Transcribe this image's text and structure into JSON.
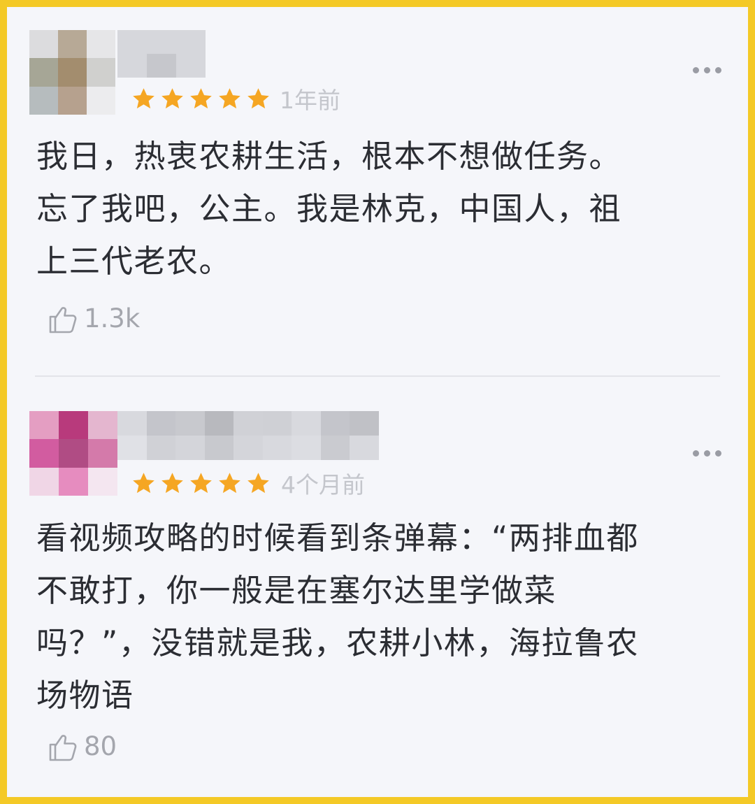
{
  "reviews": [
    {
      "time": "1年前",
      "rating": 5,
      "text_lines": [
        "我日，热衷农耕生活，根本不想做任务。",
        "忘了我吧，公主。我是林克，中国人，祖",
        "上三代老农。"
      ],
      "likes": "1.3k",
      "avatar_colors": [
        "#dcdcde",
        "#b7a996",
        "#e6e6e8",
        "#a6a696",
        "#a38d6e",
        "#d0d0ce",
        "#b6bcbe",
        "#b6a18e",
        "#ececee"
      ],
      "name_colors": [
        "#d6d7dc",
        "#d6d7dc",
        "#d6d7dc",
        "#d6d7dc",
        "#c6c7cc",
        "#d6d7dc"
      ]
    },
    {
      "time": "4个月前",
      "rating": 5,
      "text_lines": [
        "看视频攻略的时候看到条弹幕：“两排血都",
        "不敢打，你一般是在塞尔达里学做菜",
        "吗？”，没错就是我，农耕小林，海拉鲁农",
        "场物语"
      ],
      "likes": "80",
      "avatar_colors": [
        "#e49ec2",
        "#b83a7c",
        "#e4b6cf",
        "#d25ca0",
        "#b04c84",
        "#d47aaa",
        "#f0d6e6",
        "#e68cbf",
        "#f4e6f0"
      ],
      "name_colors": [
        "#d8d9de",
        "#c4c5cb",
        "#c8c9ce",
        "#b8b9be",
        "#d0d1d6",
        "#cfd0d5",
        "#d8d9de",
        "#c4c5cb",
        "#c0c1c6",
        "#e0e1e6",
        "#d0d1d6",
        "#d4d5da",
        "#c8c9ce",
        "#d4d5da",
        "#d8d9de",
        "#dcdde2",
        "#cacbd0",
        "#d8d9de"
      ]
    }
  ],
  "colors": {
    "border": "#f4c926",
    "background": "#f5f6fa",
    "star": "#f5a623",
    "text": "#2b2d33",
    "muted": "#c4c6cc"
  },
  "icons": {
    "like": "thumbs-up-icon",
    "more": "more-horizontal-icon",
    "star": "star-icon"
  }
}
